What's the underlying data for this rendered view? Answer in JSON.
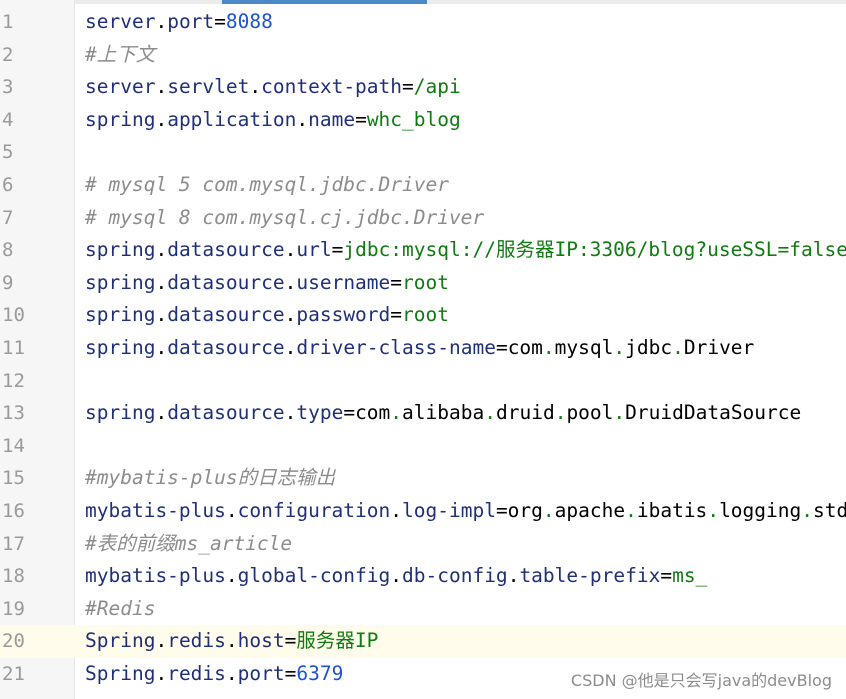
{
  "editor": {
    "lines": [
      {
        "num": "1",
        "type": "prop",
        "tokens": [
          [
            "k",
            "server"
          ],
          [
            "d",
            "."
          ],
          [
            "k",
            "port"
          ],
          [
            "e",
            "="
          ],
          [
            "n",
            "8088"
          ]
        ]
      },
      {
        "num": "2",
        "type": "comment",
        "text": "#上下文"
      },
      {
        "num": "3",
        "type": "prop",
        "tokens": [
          [
            "k",
            "server"
          ],
          [
            "d",
            "."
          ],
          [
            "k",
            "servlet"
          ],
          [
            "d",
            "."
          ],
          [
            "k",
            "context-path"
          ],
          [
            "e",
            "="
          ],
          [
            "v",
            "/api"
          ]
        ]
      },
      {
        "num": "4",
        "type": "prop",
        "tokens": [
          [
            "k",
            "spring"
          ],
          [
            "d",
            "."
          ],
          [
            "k",
            "application"
          ],
          [
            "d",
            "."
          ],
          [
            "k",
            "name"
          ],
          [
            "e",
            "="
          ],
          [
            "v",
            "whc_blog"
          ]
        ]
      },
      {
        "num": "5",
        "type": "empty"
      },
      {
        "num": "6",
        "type": "comment",
        "text": "# mysql 5 com.mysql.jdbc.Driver"
      },
      {
        "num": "7",
        "type": "comment",
        "text": "# mysql 8 com.mysql.cj.jdbc.Driver"
      },
      {
        "num": "8",
        "type": "prop",
        "tokens": [
          [
            "k",
            "spring"
          ],
          [
            "d",
            "."
          ],
          [
            "k",
            "datasource"
          ],
          [
            "d",
            "."
          ],
          [
            "k",
            "url"
          ],
          [
            "e",
            "="
          ],
          [
            "v",
            "jdbc:mysql://服务器IP:3306/blog?useSSL=false"
          ]
        ]
      },
      {
        "num": "9",
        "type": "prop",
        "tokens": [
          [
            "k",
            "spring"
          ],
          [
            "d",
            "."
          ],
          [
            "k",
            "datasource"
          ],
          [
            "d",
            "."
          ],
          [
            "k",
            "username"
          ],
          [
            "e",
            "="
          ],
          [
            "v",
            "root"
          ]
        ]
      },
      {
        "num": "10",
        "type": "prop",
        "tokens": [
          [
            "k",
            "spring"
          ],
          [
            "d",
            "."
          ],
          [
            "k",
            "datasource"
          ],
          [
            "d",
            "."
          ],
          [
            "k",
            "password"
          ],
          [
            "e",
            "="
          ],
          [
            "v",
            "root"
          ]
        ]
      },
      {
        "num": "11",
        "type": "prop",
        "tokens": [
          [
            "k",
            "spring"
          ],
          [
            "d",
            "."
          ],
          [
            "k",
            "datasource"
          ],
          [
            "d",
            "."
          ],
          [
            "k",
            "driver-class-name"
          ],
          [
            "e",
            "=com"
          ],
          [
            "v",
            "."
          ],
          [
            "e",
            "mysql"
          ],
          [
            "v",
            "."
          ],
          [
            "e",
            "jdbc"
          ],
          [
            "v",
            "."
          ],
          [
            "e",
            "Driver"
          ]
        ]
      },
      {
        "num": "12",
        "type": "empty"
      },
      {
        "num": "13",
        "type": "prop",
        "tokens": [
          [
            "k",
            "spring"
          ],
          [
            "d",
            "."
          ],
          [
            "k",
            "datasource"
          ],
          [
            "d",
            "."
          ],
          [
            "k",
            "type"
          ],
          [
            "e",
            "=com"
          ],
          [
            "v",
            "."
          ],
          [
            "e",
            "alibaba"
          ],
          [
            "v",
            "."
          ],
          [
            "e",
            "druid"
          ],
          [
            "v",
            "."
          ],
          [
            "e",
            "pool"
          ],
          [
            "v",
            "."
          ],
          [
            "e",
            "DruidDataSource"
          ]
        ]
      },
      {
        "num": "14",
        "type": "empty"
      },
      {
        "num": "15",
        "type": "comment",
        "text": "#mybatis-plus的日志输出"
      },
      {
        "num": "16",
        "type": "prop",
        "tokens": [
          [
            "k",
            "mybatis-plus"
          ],
          [
            "d",
            "."
          ],
          [
            "k",
            "configuration"
          ],
          [
            "d",
            "."
          ],
          [
            "k",
            "log-impl"
          ],
          [
            "e",
            "=org"
          ],
          [
            "v",
            "."
          ],
          [
            "e",
            "apache"
          ],
          [
            "v",
            "."
          ],
          [
            "e",
            "ibatis"
          ],
          [
            "v",
            "."
          ],
          [
            "e",
            "logging"
          ],
          [
            "v",
            "."
          ],
          [
            "e",
            "stdout"
          ]
        ]
      },
      {
        "num": "17",
        "type": "comment",
        "text": "#表的前缀ms_article"
      },
      {
        "num": "18",
        "type": "prop",
        "tokens": [
          [
            "k",
            "mybatis-plus"
          ],
          [
            "d",
            "."
          ],
          [
            "k",
            "global-config"
          ],
          [
            "d",
            "."
          ],
          [
            "k",
            "db-config"
          ],
          [
            "d",
            "."
          ],
          [
            "k",
            "table-prefix"
          ],
          [
            "e",
            "="
          ],
          [
            "v",
            "ms_"
          ]
        ]
      },
      {
        "num": "19",
        "type": "comment",
        "text": "#Redis"
      },
      {
        "num": "20",
        "type": "prop",
        "current": true,
        "tokens": [
          [
            "k",
            "Spring"
          ],
          [
            "d",
            "."
          ],
          [
            "k",
            "redis"
          ],
          [
            "d",
            "."
          ],
          [
            "k",
            "host"
          ],
          [
            "e",
            "="
          ],
          [
            "v",
            "服务器IP"
          ]
        ]
      },
      {
        "num": "21",
        "type": "prop",
        "tokens": [
          [
            "k",
            "Spring"
          ],
          [
            "d",
            "."
          ],
          [
            "k",
            "redis"
          ],
          [
            "d",
            "."
          ],
          [
            "k",
            "port"
          ],
          [
            "e",
            "="
          ],
          [
            "n",
            "6379"
          ]
        ]
      }
    ]
  },
  "watermark": "CSDN @他是只会写java的devBlog",
  "colors": {
    "key": "#1f2f7a",
    "value": "#107b10",
    "number": "#1d53d3",
    "comment": "#8c8c8c",
    "current_line": "#fffceb",
    "gutter": "#f6f6f6",
    "tab_active": "#4a88c7"
  }
}
